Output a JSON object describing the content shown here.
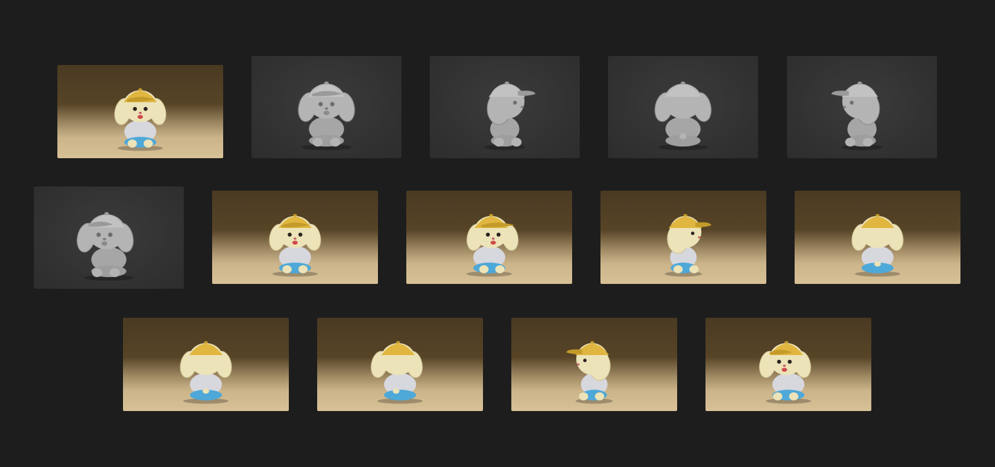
{
  "gallery": {
    "description_palette": {
      "background": "#1d1d1d",
      "clay_tile": "#333333",
      "clay_model": "#a9a9a9",
      "cap_yellow": "#e0b640",
      "fur_cream": "#ece3b8",
      "shorts_blue": "#4ea8d8",
      "tongue_red": "#d04a4a"
    },
    "rows": [
      {
        "tiles": [
          {
            "style": "render",
            "view": "front",
            "icon": "character-front-render"
          },
          {
            "style": "clay",
            "view": "front",
            "icon": "character-front-clay"
          },
          {
            "style": "clay",
            "view": "right-side",
            "icon": "character-right-clay"
          },
          {
            "style": "clay",
            "view": "back",
            "icon": "character-back-clay"
          },
          {
            "style": "clay",
            "view": "left-side",
            "icon": "character-left-clay"
          }
        ]
      },
      {
        "tiles": [
          {
            "style": "clay",
            "view": "three-quarter-left",
            "icon": "character-three-quarter-clay"
          },
          {
            "style": "render",
            "view": "front",
            "icon": "character-front-render"
          },
          {
            "style": "render",
            "view": "three-quarter-right",
            "icon": "character-three-quarter-right-render"
          },
          {
            "style": "render",
            "view": "right-side",
            "icon": "character-right-render"
          },
          {
            "style": "render",
            "view": "back-three-quarter",
            "icon": "character-back-three-quarter-render"
          }
        ]
      },
      {
        "tiles": [
          {
            "style": "render",
            "view": "back",
            "icon": "character-back-render"
          },
          {
            "style": "render",
            "view": "back-three-quarter-left",
            "icon": "character-back-left-render"
          },
          {
            "style": "render",
            "view": "left-side",
            "icon": "character-left-render"
          },
          {
            "style": "render",
            "view": "three-quarter-left",
            "icon": "character-three-quarter-left-render"
          }
        ]
      }
    ]
  }
}
